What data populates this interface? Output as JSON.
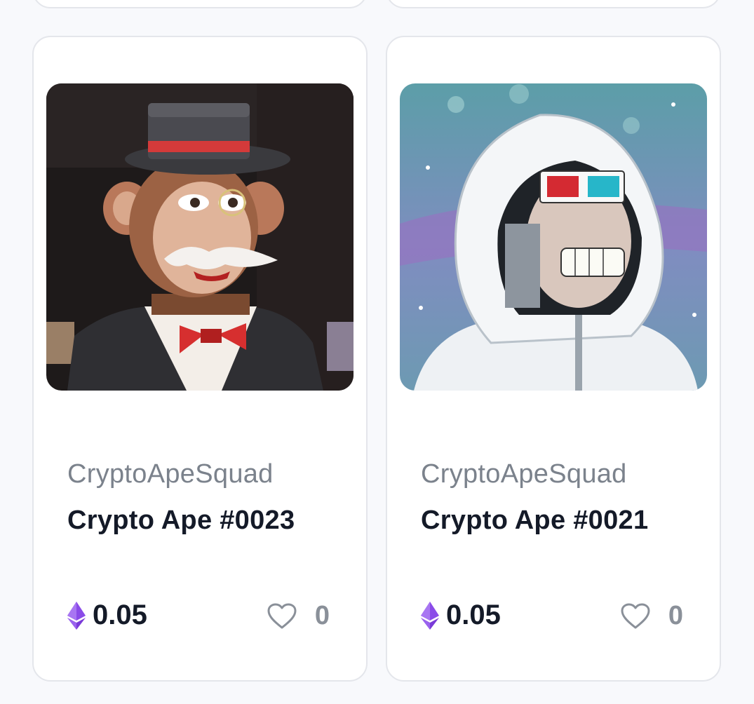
{
  "colors": {
    "background": "#f8f9fc",
    "card_border": "#e4e6eb",
    "eth_purple": "#8a4be8",
    "heart_gray": "#8a9099"
  },
  "cards": [
    {
      "collection": "CryptoApeSquad",
      "name": "Crypto Ape #0023",
      "price": "0.05",
      "currency_icon": "ethereum-icon",
      "likes": "0",
      "image": "ape-top-hat-monocle"
    },
    {
      "collection": "CryptoApeSquad",
      "name": "Crypto Ape #0021",
      "price": "0.05",
      "currency_icon": "ethereum-icon",
      "likes": "0",
      "image": "ape-hoodie-3d-glasses"
    }
  ]
}
